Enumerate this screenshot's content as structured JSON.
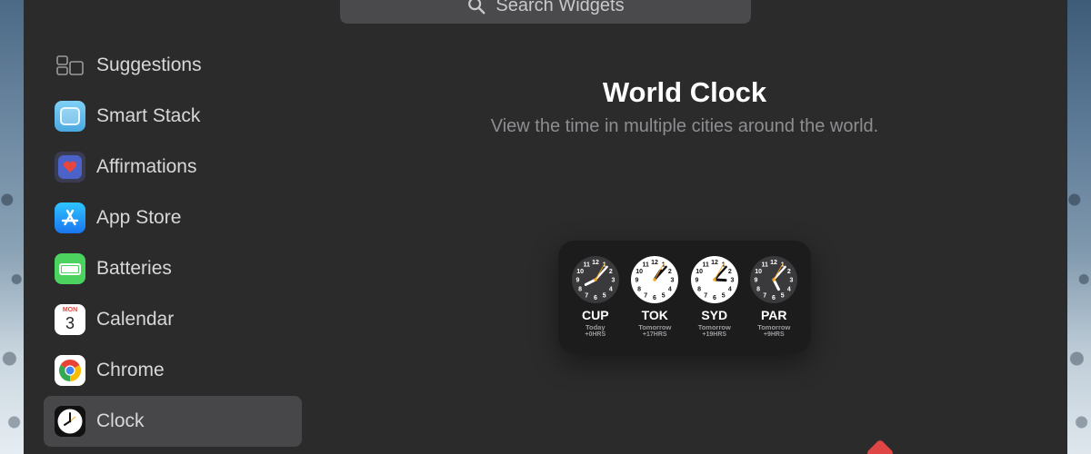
{
  "search": {
    "placeholder": "Search Widgets"
  },
  "sidebar": {
    "items": [
      {
        "label": "Suggestions",
        "icon": "suggestions-icon"
      },
      {
        "label": "Smart Stack",
        "icon": "smart-stack-icon"
      },
      {
        "label": "Affirmations",
        "icon": "affirmations-icon"
      },
      {
        "label": "App Store",
        "icon": "app-store-icon"
      },
      {
        "label": "Batteries",
        "icon": "batteries-icon"
      },
      {
        "label": "Calendar",
        "icon": "calendar-icon",
        "month": "MON",
        "day": "3"
      },
      {
        "label": "Chrome",
        "icon": "chrome-icon"
      },
      {
        "label": "Clock",
        "icon": "clock-icon",
        "selected": true
      }
    ]
  },
  "detail": {
    "title": "World Clock",
    "description": "View the time in multiple cities around the world."
  },
  "widget": {
    "cities": [
      {
        "code": "CUP",
        "day": "Today",
        "offset": "+0HRS",
        "face": "dark",
        "hour": 8.1,
        "minute": 7,
        "second": 5
      },
      {
        "code": "TOK",
        "day": "Tomorrow",
        "offset": "+17HRS",
        "face": "light",
        "hour": 1.1,
        "minute": 7,
        "second": 5
      },
      {
        "code": "SYD",
        "day": "Tomorrow",
        "offset": "+19HRS",
        "face": "light",
        "hour": 3.1,
        "minute": 7,
        "second": 5
      },
      {
        "code": "PAR",
        "day": "Tomorrow",
        "offset": "+9HRS",
        "face": "dark",
        "hour": 5.1,
        "minute": 7,
        "second": 5
      }
    ]
  },
  "colors": {
    "accent_orange": "#f5a623",
    "selected_row": "#474749",
    "background": "#2b2b2c"
  }
}
